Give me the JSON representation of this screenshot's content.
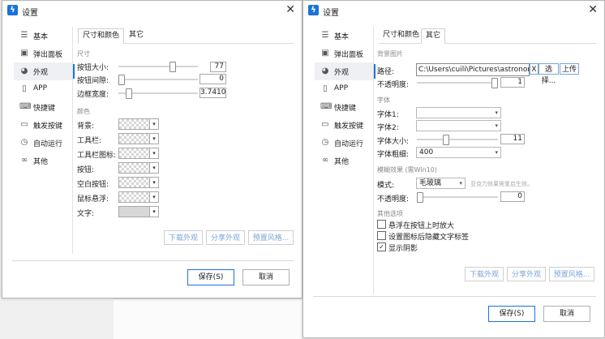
{
  "app": {
    "title": "设置",
    "close_glyph": "✕",
    "app_icon_glyph": "ϟ"
  },
  "sidebar": {
    "items": [
      {
        "label": "基本",
        "icon": "sliders-icon",
        "glyph": "☰"
      },
      {
        "label": "弹出面板",
        "icon": "panel-icon",
        "glyph": "▣"
      },
      {
        "label": "外观",
        "icon": "palette-icon",
        "glyph": "◕"
      },
      {
        "label": "APP",
        "icon": "phone-icon",
        "glyph": "▯"
      },
      {
        "label": "快捷键",
        "icon": "keyboard-icon",
        "glyph": "⌨"
      },
      {
        "label": "触发按键",
        "icon": "key-icon",
        "glyph": "▭"
      },
      {
        "label": "自动运行",
        "icon": "clock-icon",
        "glyph": "◷"
      },
      {
        "label": "其他",
        "icon": "link-icon",
        "glyph": "∞"
      }
    ]
  },
  "tabs": {
    "size_color": "尺寸和颜色",
    "other": "其它"
  },
  "w1": {
    "size_header": "尺寸",
    "button_size": {
      "label": "按钮大小:",
      "value": "77"
    },
    "button_gap": {
      "label": "按钮间隙:",
      "value": "0"
    },
    "border_width": {
      "label": "边框宽度:",
      "value": "3.7410"
    },
    "color_header": "颜色",
    "colors": [
      "背景:",
      "工具栏:",
      "工具栏图标:",
      "按钮:",
      "空白按钮:",
      "鼠标悬浮:",
      "文字:"
    ],
    "dropdown_glyph": "▾"
  },
  "buttons": {
    "download": "下载外观",
    "share": "分享外观",
    "preset": "预置风格...",
    "save": "保存(S)",
    "cancel": "取消"
  },
  "w2": {
    "bg_header": "背景图片",
    "path": {
      "label": "路径:",
      "value": "C:\\Users\\cuili\\Pictures\\astronomy",
      "clear": "X",
      "choose": "选择...",
      "upload": "上传"
    },
    "bg_opacity": {
      "label": "不透明度:",
      "value": "1"
    },
    "font_header": "字体",
    "font1": {
      "label": "字体1:",
      "value": ""
    },
    "font2": {
      "label": "字体2:",
      "value": ""
    },
    "font_size": {
      "label": "字体大小:",
      "value": "11"
    },
    "font_weight": {
      "label": "字体粗细:",
      "value": "400"
    },
    "blur_header": "模糊效果 (需Win10)",
    "mode": {
      "label": "模式:",
      "value": "毛玻璃",
      "hint": "亚克力效果需重启生效。"
    },
    "blur_opacity": {
      "label": "不透明度:",
      "value": "0"
    },
    "other_header": "其他选项",
    "options": [
      {
        "label": "悬浮在按钮上时放大",
        "checked": false
      },
      {
        "label": "设置图标后隐藏文字标签",
        "checked": false
      },
      {
        "label": "显示阴影",
        "checked": true
      }
    ],
    "check_glyph": "✓"
  },
  "sliders": {
    "button_size": 0.7,
    "button_gap": 0.0,
    "border_width": 0.1,
    "bg_opacity": 1.0,
    "font_size": 0.35,
    "blur_opacity": 0.0
  },
  "colors": {
    "accent": "#1a73d9",
    "link_text": "#7aa5d8"
  }
}
